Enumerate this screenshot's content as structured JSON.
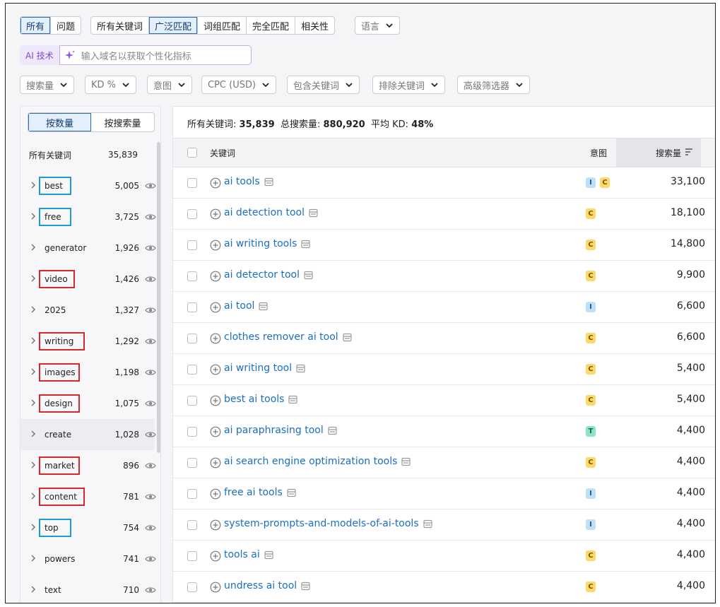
{
  "scope_tabs": [
    {
      "label": "所有",
      "active": true
    },
    {
      "label": "问题",
      "active": false
    }
  ],
  "match_tabs": [
    {
      "label": "所有关键词",
      "active": false
    },
    {
      "label": "广泛匹配",
      "active": true
    },
    {
      "label": "词组匹配",
      "active": false
    },
    {
      "label": "完全匹配",
      "active": false
    },
    {
      "label": "相关性",
      "active": false
    }
  ],
  "language_dropdown": "语言",
  "ai": {
    "badge": "AI 技术",
    "placeholder": "输入域名以获取个性化指标"
  },
  "filters": [
    "搜索量",
    "KD %",
    "意图",
    "CPC (USD)",
    "包含关键词",
    "排除关键词",
    "高级筛选器"
  ],
  "left": {
    "toggle": [
      {
        "label": "按数量",
        "active": true
      },
      {
        "label": "按搜索量",
        "active": false
      }
    ],
    "all_label": "所有关键词",
    "all_count": "35,839",
    "groups": [
      {
        "name": "best",
        "count": "5,005",
        "box": "blue"
      },
      {
        "name": "free",
        "count": "3,725",
        "box": "blue"
      },
      {
        "name": "generator",
        "count": "1,926",
        "box": ""
      },
      {
        "name": "video",
        "count": "1,426",
        "box": "red"
      },
      {
        "name": "2025",
        "count": "1,327",
        "box": ""
      },
      {
        "name": "writing",
        "count": "1,292",
        "box": "red"
      },
      {
        "name": "images",
        "count": "1,198",
        "box": "red"
      },
      {
        "name": "design",
        "count": "1,075",
        "box": "red"
      },
      {
        "name": "create",
        "count": "1,028",
        "box": ""
      },
      {
        "name": "market",
        "count": "896",
        "box": "red"
      },
      {
        "name": "content",
        "count": "781",
        "box": "red"
      },
      {
        "name": "top",
        "count": "754",
        "box": "blue"
      },
      {
        "name": "powers",
        "count": "741",
        "box": ""
      },
      {
        "name": "text",
        "count": "710",
        "box": ""
      }
    ]
  },
  "summary": {
    "all_label": "所有关键词:",
    "all_value": "35,839",
    "volume_label": "总搜索量:",
    "volume_value": "880,920",
    "kd_label": "平均 KD:",
    "kd_value": "48%"
  },
  "table": {
    "col_keyword": "关键词",
    "col_intent": "意图",
    "col_volume": "搜索量",
    "rows": [
      {
        "keyword": "ai tools",
        "intents": [
          "I",
          "C"
        ],
        "volume": "33,100"
      },
      {
        "keyword": "ai detection tool",
        "intents": [
          "C"
        ],
        "volume": "18,100"
      },
      {
        "keyword": "ai writing tools",
        "intents": [
          "C"
        ],
        "volume": "14,800"
      },
      {
        "keyword": "ai detector tool",
        "intents": [
          "C"
        ],
        "volume": "9,900"
      },
      {
        "keyword": "ai tool",
        "intents": [
          "I"
        ],
        "volume": "6,600"
      },
      {
        "keyword": "clothes remover ai tool",
        "intents": [
          "C"
        ],
        "volume": "6,600"
      },
      {
        "keyword": "ai writing tool",
        "intents": [
          "C"
        ],
        "volume": "5,400"
      },
      {
        "keyword": "best ai tools",
        "intents": [
          "C"
        ],
        "volume": "5,400"
      },
      {
        "keyword": "ai paraphrasing tool",
        "intents": [
          "T"
        ],
        "volume": "4,400"
      },
      {
        "keyword": "ai search engine optimization tools",
        "intents": [
          "C"
        ],
        "volume": "4,400"
      },
      {
        "keyword": "free ai tools",
        "intents": [
          "I"
        ],
        "volume": "4,400"
      },
      {
        "keyword": "system-prompts-and-models-of-ai-tools",
        "intents": [
          "I"
        ],
        "volume": "4,400"
      },
      {
        "keyword": "tools ai",
        "intents": [
          "C"
        ],
        "volume": "4,400"
      },
      {
        "keyword": "undress ai tool",
        "intents": [
          "C"
        ],
        "volume": "4,400"
      }
    ]
  },
  "colors": {
    "accent_blue": "#2a6db3",
    "link": "#1a6fc4",
    "highlight_blue": "#1a9bd7",
    "highlight_red": "#d8262c"
  }
}
